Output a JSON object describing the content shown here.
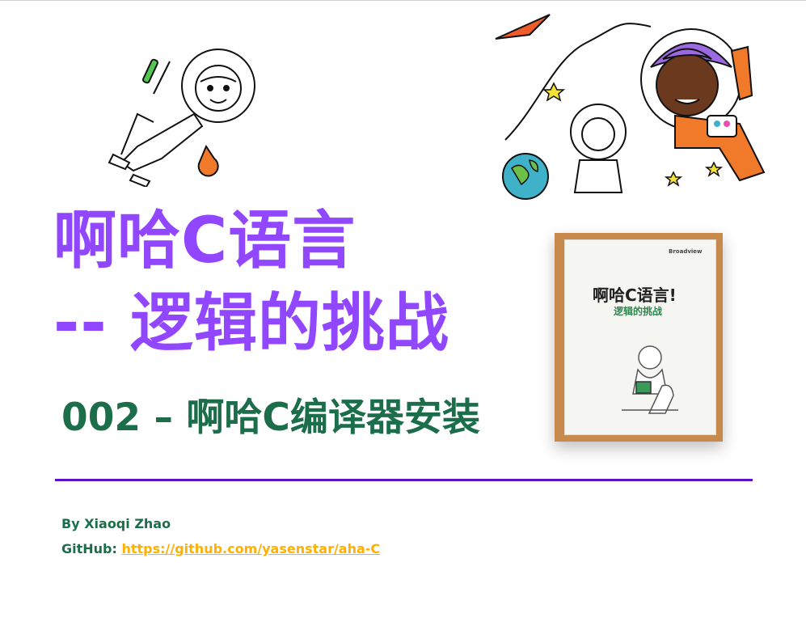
{
  "title": {
    "line1": "啊哈C语言",
    "line2": "-- 逻辑的挑战"
  },
  "subtitle": "002 – 啊哈C编译器安装",
  "author": "By Xiaoqi Zhao",
  "github": {
    "label": "GitHub: ",
    "url_text": "https://github.com/yasenstar/aha-C"
  },
  "book": {
    "title": "啊哈C语言!",
    "subtitle": "逻辑的挑战",
    "publisher_mark": "Broadview"
  },
  "icons": [
    "scientist-astronaut-icon",
    "space-kids-illustration-icon",
    "book-cover-photo"
  ],
  "colors": {
    "title": "#9146ff",
    "subtitle": "#1c6e4b",
    "divider": "#5a12c8",
    "link": "#ffb000"
  }
}
